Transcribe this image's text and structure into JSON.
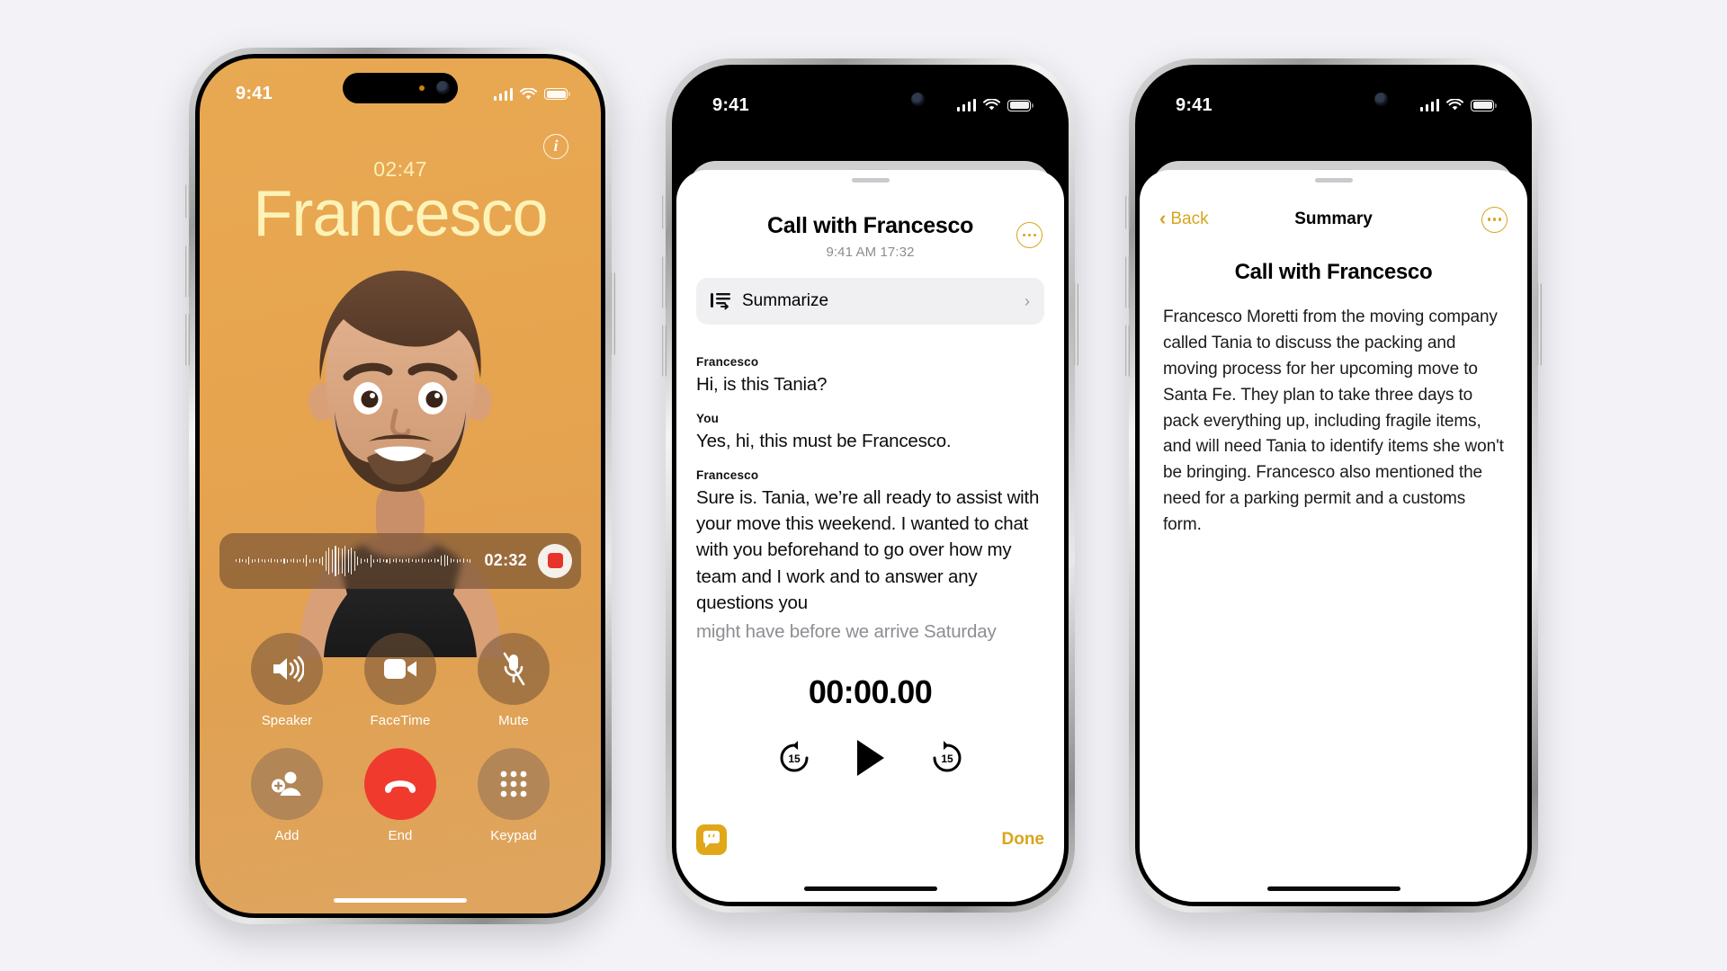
{
  "background_color": "#f2f2f7",
  "accent_color": "#d9a51e",
  "phone1": {
    "name": "active-call-screen",
    "status_bar": {
      "time": "9:41",
      "signal_icon": "cellular-bars-icon",
      "wifi_icon": "wifi-icon",
      "battery_icon": "battery-icon"
    },
    "info_button_label": "i",
    "call_timer": "02:47",
    "caller_name": "Francesco",
    "avatar": "memoji-avatar",
    "recording": {
      "waveform_icon": "audio-waveform-icon",
      "elapsed": "02:32",
      "stop_button_label": "stop-recording"
    },
    "controls": [
      {
        "label": "Speaker",
        "icon": "speaker-icon",
        "style": "dark"
      },
      {
        "label": "FaceTime",
        "icon": "video-icon",
        "style": "dark"
      },
      {
        "label": "Mute",
        "icon": "mic-slash-icon",
        "style": "dark"
      },
      {
        "label": "Add",
        "icon": "add-person-icon",
        "style": "light"
      },
      {
        "label": "End",
        "icon": "end-call-icon",
        "style": "end"
      },
      {
        "label": "Keypad",
        "icon": "keypad-icon",
        "style": "light"
      }
    ],
    "end_button_color": "#f03a2e",
    "background_color": "#e8a953"
  },
  "phone2": {
    "name": "call-transcript-sheet",
    "status_bar": {
      "time": "9:41"
    },
    "title": "Call with Francesco",
    "subtitle": "9:41 AM  17:32",
    "more_button": "more-options",
    "summarize": {
      "label": "Summarize",
      "icon": "summarize-icon",
      "chevron": "›"
    },
    "transcript": [
      {
        "speaker": "Francesco",
        "text": "Hi, is this Tania?",
        "faded": false
      },
      {
        "speaker": "You",
        "text": "Yes, hi, this must be Francesco.",
        "faded": false
      },
      {
        "speaker": "Francesco",
        "text": "Sure is. Tania, we’re all ready to assist with your move this weekend. I wanted to chat with you beforehand to go over how my team and I work and to answer any questions you",
        "faded": false
      },
      {
        "speaker": "",
        "text": "might have before we arrive Saturday",
        "faded": true
      }
    ],
    "player": {
      "time": "00:00.00",
      "back_label": "15",
      "forward_label": "15",
      "play_icon": "play-icon",
      "back_icon": "skip-back-15-icon",
      "forward_icon": "skip-forward-15-icon"
    },
    "footer": {
      "live_transcript_icon": "live-transcript-icon",
      "done_label": "Done"
    }
  },
  "phone3": {
    "name": "call-summary-screen",
    "status_bar": {
      "time": "9:41"
    },
    "back_label": "Back",
    "nav_title": "Summary",
    "more_button": "more-options",
    "title": "Call with Francesco",
    "body": "Francesco Moretti from the moving company called Tania to discuss the packing and moving process for her upcoming move to Santa Fe. They plan to take three days to pack everything up, including fragile items, and will need Tania to identify items she won't be bringing. Francesco also mentioned the need for a parking permit and a customs form."
  }
}
